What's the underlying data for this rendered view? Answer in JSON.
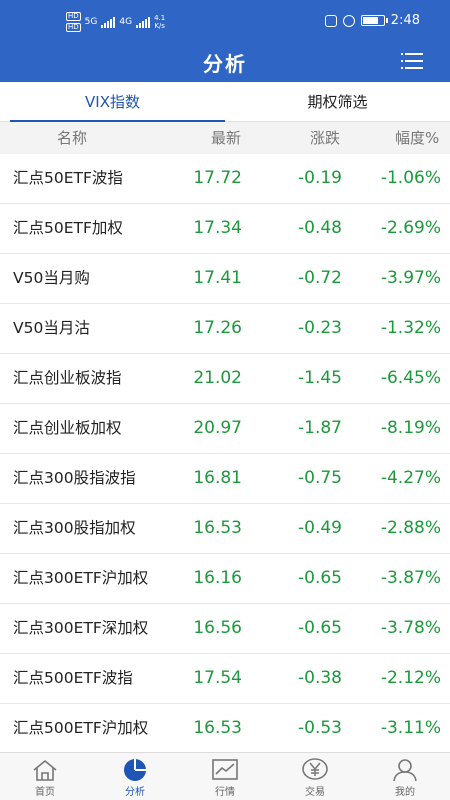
{
  "status_bar": {
    "hd1": "HD",
    "hd2": "HD",
    "net_gen": "5G",
    "net_gen2": "4G",
    "speed": "4.1",
    "speed_unit": "K/s",
    "time": "2:48",
    "battery_label": "77",
    "battery_level": 0.77
  },
  "header": {
    "title": "分析",
    "menu_icon": "list-menu-icon"
  },
  "tabs": [
    {
      "label": "VIX指数",
      "active": true
    },
    {
      "label": "期权筛选",
      "active": false
    }
  ],
  "columns": {
    "name": "名称",
    "latest": "最新",
    "change": "涨跌",
    "percent": "幅度%"
  },
  "rows": [
    {
      "name": "汇点50ETF波指",
      "latest": "17.72",
      "change": "-0.19",
      "percent": "-1.06%"
    },
    {
      "name": "汇点50ETF加权",
      "latest": "17.34",
      "change": "-0.48",
      "percent": "-2.69%"
    },
    {
      "name": "V50当月购",
      "latest": "17.41",
      "change": "-0.72",
      "percent": "-3.97%"
    },
    {
      "name": "V50当月沽",
      "latest": "17.26",
      "change": "-0.23",
      "percent": "-1.32%"
    },
    {
      "name": "汇点创业板波指",
      "latest": "21.02",
      "change": "-1.45",
      "percent": "-6.45%"
    },
    {
      "name": "汇点创业板加权",
      "latest": "20.97",
      "change": "-1.87",
      "percent": "-8.19%"
    },
    {
      "name": "汇点300股指波指",
      "latest": "16.81",
      "change": "-0.75",
      "percent": "-4.27%"
    },
    {
      "name": "汇点300股指加权",
      "latest": "16.53",
      "change": "-0.49",
      "percent": "-2.88%"
    },
    {
      "name": "汇点300ETF沪加权",
      "latest": "16.16",
      "change": "-0.65",
      "percent": "-3.87%"
    },
    {
      "name": "汇点300ETF深加权",
      "latest": "16.56",
      "change": "-0.65",
      "percent": "-3.78%"
    },
    {
      "name": "汇点500ETF波指",
      "latest": "17.54",
      "change": "-0.38",
      "percent": "-2.12%"
    },
    {
      "name": "汇点500ETF沪加权",
      "latest": "16.53",
      "change": "-0.53",
      "percent": "-3.11%"
    }
  ],
  "colors": {
    "brand": "#2f66c6",
    "accent": "#1f55b5",
    "negative": "#1a9a3a"
  },
  "bottom_nav": [
    {
      "label": "首页",
      "icon": "home-icon",
      "active": false
    },
    {
      "label": "分析",
      "icon": "pie-chart-icon",
      "active": true
    },
    {
      "label": "行情",
      "icon": "market-chart-icon",
      "active": false
    },
    {
      "label": "交易",
      "icon": "yen-coin-icon",
      "active": false
    },
    {
      "label": "我的",
      "icon": "user-icon",
      "active": false
    }
  ]
}
